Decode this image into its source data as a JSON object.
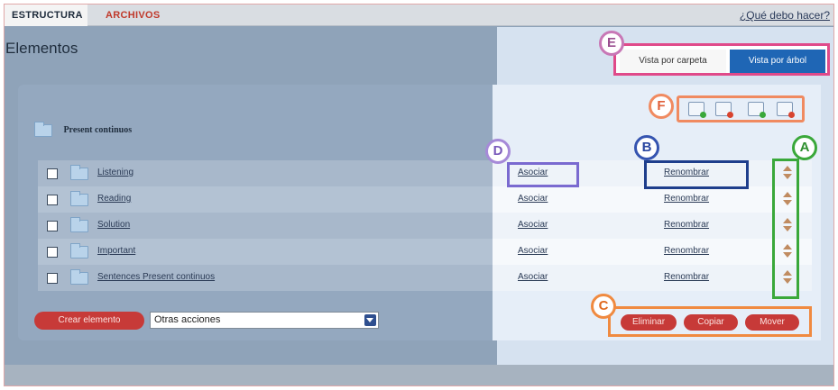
{
  "tabs": [
    {
      "label": "ESTRUCTURA"
    },
    {
      "label": "ARCHIVOS"
    }
  ],
  "help_link": "¿Qué debo hacer?",
  "page_title": "Elementos",
  "view_toggle": {
    "folder_view": "Vista por carpeta",
    "tree_view": "Vista por árbol"
  },
  "root_folder": "Present continuos",
  "toolbar_icons": [
    "add-folder-icon",
    "remove-folder-icon",
    "move-in-icon",
    "move-out-icon"
  ],
  "rows": [
    {
      "name": "Listening",
      "associate": "Asociar",
      "rename": "Renombrar"
    },
    {
      "name": "Reading",
      "associate": "Asociar",
      "rename": "Renombrar"
    },
    {
      "name": "Solution",
      "associate": "Asociar",
      "rename": "Renombrar"
    },
    {
      "name": "Important",
      "associate": "Asociar",
      "rename": "Renombrar"
    },
    {
      "name": "Sentences Present continuos",
      "associate": "Asociar",
      "rename": "Renombrar"
    }
  ],
  "bottom": {
    "create_button": "Crear elemento",
    "actions_select": "Otras acciones",
    "delete_button": "Eliminar",
    "copy_button": "Copiar",
    "move_button": "Mover"
  },
  "annotations": {
    "a": "A",
    "b": "B",
    "c": "C",
    "d": "D",
    "e": "E",
    "f": "F"
  },
  "colors": {
    "accent_red": "#c73a38",
    "tree_view_blue": "#1f66b5",
    "annotation_e": "#e04a8a",
    "annotation_f": "#f08a60",
    "annotation_d": "#7a6ad0",
    "annotation_b": "#1e3e8c",
    "annotation_a": "#3aa83a",
    "annotation_c": "#f08a40"
  }
}
